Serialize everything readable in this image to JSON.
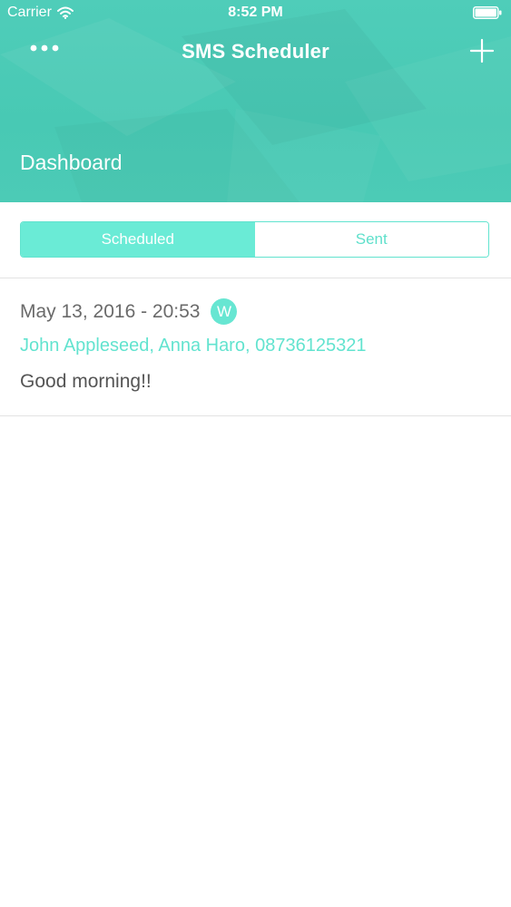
{
  "status_bar": {
    "carrier": "Carrier",
    "time": "8:52 PM"
  },
  "nav": {
    "title": "SMS Scheduler",
    "more_icon": "ellipsis-icon",
    "add_icon": "plus-icon"
  },
  "header": {
    "section_title": "Dashboard"
  },
  "tabs": [
    {
      "label": "Scheduled",
      "selected": true
    },
    {
      "label": "Sent",
      "selected": false
    }
  ],
  "messages": [
    {
      "date": "May 13, 2016 - 20:53",
      "repeat_badge": "W",
      "recipients": "John Appleseed, Anna Haro, 08736125321",
      "text": "Good morning!!"
    }
  ],
  "colors": {
    "header_bg": "#4ccbb6",
    "accent": "#62e3cf",
    "segment_active": "#6aebd6",
    "text_gray": "#6a6a6a"
  }
}
